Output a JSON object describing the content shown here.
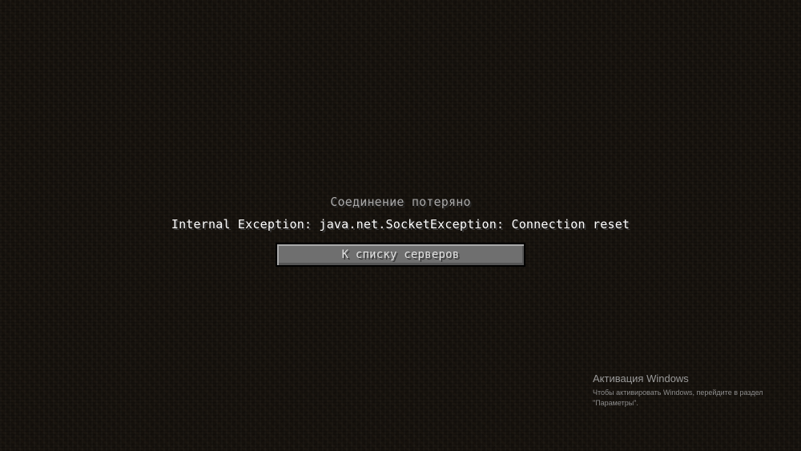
{
  "disconnect_screen": {
    "title": "Соединение потеряно",
    "reason": "Internal Exception: java.net.SocketException: Connection reset",
    "back_button_label": "К списку серверов"
  },
  "windows_activation_watermark": {
    "title": "Активация Windows",
    "line1": "Чтобы активировать Windows, перейдите в раздел",
    "line2": "\"Параметры\"."
  },
  "colors": {
    "background": "#16120d",
    "title_text": "#a8a8a8",
    "reason_text": "#ffffff",
    "button_face": "#6f6f6f",
    "button_text": "#e0e0e0"
  }
}
